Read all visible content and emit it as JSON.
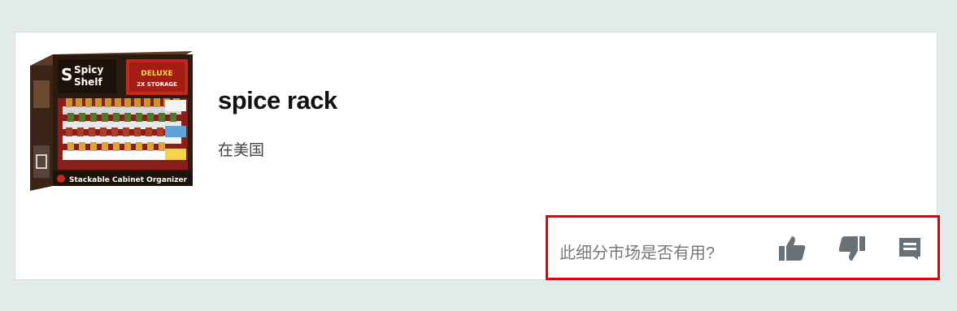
{
  "product": {
    "title": "spice rack",
    "market": "在美国",
    "image": {
      "brand_line1": "Spicy",
      "brand_line2": "Shelf",
      "badge_line1": "DELUXE",
      "badge_line2": "2X STORAGE",
      "caption": "Stackable Cabinet Organizer"
    }
  },
  "feedback": {
    "question": "此细分市场是否有用?",
    "icons": [
      "thumbs-up-icon",
      "thumbs-down-icon",
      "comment-icon"
    ],
    "highlight_color": "#e3000b",
    "icon_color": "#687078"
  }
}
